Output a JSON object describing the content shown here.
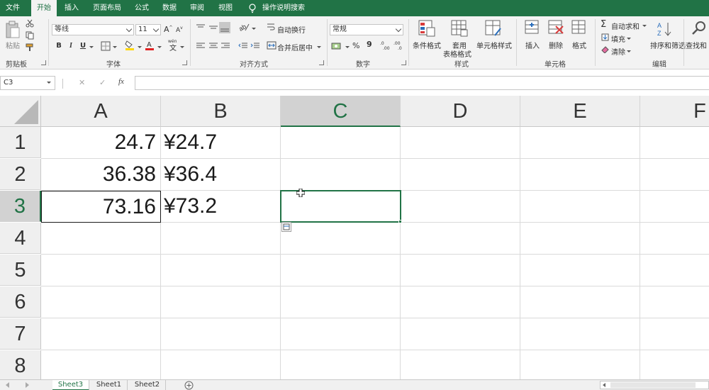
{
  "ribbon_tabs": [
    {
      "label": "文件",
      "active": false
    },
    {
      "label": "开始",
      "active": true
    },
    {
      "label": "插入",
      "active": false
    },
    {
      "label": "页面布局",
      "active": false
    },
    {
      "label": "公式",
      "active": false
    },
    {
      "label": "数据",
      "active": false
    },
    {
      "label": "审阅",
      "active": false
    },
    {
      "label": "视图",
      "active": false
    },
    {
      "label": "操作说明搜索",
      "active": false
    }
  ],
  "ribbon": {
    "clipboard": {
      "paste_label": "粘贴",
      "group_label": "剪贴板"
    },
    "font": {
      "font_name": "等线",
      "font_size": "11",
      "bold": "B",
      "italic": "I",
      "underline": "U",
      "group_label": "字体"
    },
    "alignment": {
      "wrap_label": "自动换行",
      "merge_label": "合并后居中",
      "group_label": "对齐方式"
    },
    "number": {
      "format_value": "常规",
      "percent": "%",
      "comma": "9",
      "group_label": "数字"
    },
    "styles": {
      "conditional_label": "条件格式",
      "table_label_1": "套用",
      "table_label_2": "表格格式",
      "cell_style_label": "单元格样式",
      "group_label": "样式"
    },
    "cells": {
      "insert_label": "插入",
      "delete_label": "删除",
      "format_label": "格式",
      "group_label": "单元格"
    },
    "editing": {
      "autosum_label": "自动求和",
      "fill_label": "填充",
      "clear_label": "清除",
      "sort_label": "排序和筛选",
      "find_label": "查找和",
      "group_label": "编辑"
    }
  },
  "formula_bar": {
    "name_box": "C3",
    "fx": "fx",
    "cancel": "✕",
    "enter": "✓",
    "formula": ""
  },
  "grid": {
    "columns": [
      {
        "label": "A",
        "selected": false
      },
      {
        "label": "B",
        "selected": false
      },
      {
        "label": "C",
        "selected": true
      },
      {
        "label": "D",
        "selected": false
      },
      {
        "label": "E",
        "selected": false
      },
      {
        "label": "F",
        "selected": false
      }
    ],
    "rows": [
      {
        "label": "1",
        "selected": false,
        "cells": [
          "24.7",
          "¥24.7",
          "",
          "",
          "",
          ""
        ]
      },
      {
        "label": "2",
        "selected": false,
        "cells": [
          "36.38",
          "¥36.4",
          "",
          "",
          "",
          ""
        ]
      },
      {
        "label": "3",
        "selected": true,
        "cells": [
          "73.16",
          "¥73.2",
          "",
          "",
          "",
          ""
        ]
      },
      {
        "label": "4",
        "selected": false,
        "cells": [
          "",
          "",
          "",
          "",
          "",
          ""
        ]
      },
      {
        "label": "5",
        "selected": false,
        "cells": [
          "",
          "",
          "",
          "",
          "",
          ""
        ]
      },
      {
        "label": "6",
        "selected": false,
        "cells": [
          "",
          "",
          "",
          "",
          "",
          ""
        ]
      },
      {
        "label": "7",
        "selected": false,
        "cells": [
          "",
          "",
          "",
          "",
          "",
          ""
        ]
      },
      {
        "label": "8",
        "selected": false,
        "cells": [
          "",
          "",
          "",
          "",
          "",
          ""
        ]
      }
    ],
    "active_cell": "C3"
  },
  "sheet_tabs": [
    {
      "label": "Sheet3",
      "active": true
    },
    {
      "label": "Sheet1",
      "active": false
    },
    {
      "label": "Sheet2",
      "active": false
    }
  ],
  "colors": {
    "accent": "#217346",
    "header_bg": "#efefef",
    "header_selected_bg": "#d2d2d2",
    "gridline": "#dadada",
    "ribbon_bg": "#f3f3f3"
  }
}
